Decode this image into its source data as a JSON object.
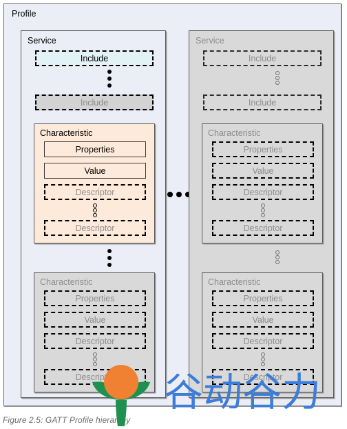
{
  "figure": {
    "caption": "Figure 2.5: GATT Profile hierarchy",
    "profile_label": "Profile"
  },
  "labels": {
    "service": "Service",
    "include": "Include",
    "characteristic": "Characteristic",
    "properties": "Properties",
    "value": "Value",
    "descriptor": "Descriptor"
  },
  "colors": {
    "profile_bg": "#eceef7",
    "service_active_bg": "#eceef7",
    "service_dim_bg": "#d9d9d9",
    "include_active_bg": "#e3f2f7",
    "include_dim_bg": "#d3d3d3",
    "characteristic_active_bg": "#fdeada",
    "characteristic_dim_bg": "#d9d9d9",
    "dim_text": "#8d8d8d",
    "active_text": "#000000",
    "border": "#555555",
    "caption_text": "#6b6b6b",
    "watermark_blue": "#3b7dd8",
    "watermark_orange": "#f08032",
    "watermark_green": "#1e9150"
  },
  "structure": {
    "services": [
      {
        "name": "Service",
        "state": "active",
        "includes": [
          {
            "label": "Include",
            "state": "active"
          },
          {
            "label": "Include",
            "state": "dim"
          }
        ],
        "characteristics": [
          {
            "name": "Characteristic",
            "state": "active",
            "properties": {
              "label": "Properties",
              "state": "active"
            },
            "value": {
              "label": "Value",
              "state": "active"
            },
            "descriptors": [
              {
                "label": "Descriptor",
                "state": "dim"
              },
              {
                "label": "Descriptor",
                "state": "dim"
              }
            ]
          },
          {
            "name": "Characteristic",
            "state": "dim",
            "properties": {
              "label": "Properties",
              "state": "dim"
            },
            "value": {
              "label": "Value",
              "state": "dim"
            },
            "descriptors": [
              {
                "label": "Descriptor",
                "state": "dim"
              },
              {
                "label": "Descriptor",
                "state": "dim"
              }
            ]
          }
        ]
      },
      {
        "name": "Service",
        "state": "dim",
        "includes": [
          {
            "label": "Include",
            "state": "dim"
          },
          {
            "label": "Include",
            "state": "dim"
          }
        ],
        "characteristics": [
          {
            "name": "Characteristic",
            "state": "dim",
            "properties": {
              "label": "Properties",
              "state": "dim"
            },
            "value": {
              "label": "Value",
              "state": "dim"
            },
            "descriptors": [
              {
                "label": "Descriptor",
                "state": "dim"
              },
              {
                "label": "Descriptor",
                "state": "dim"
              }
            ]
          },
          {
            "name": "Characteristic",
            "state": "dim",
            "properties": {
              "label": "Properties",
              "state": "dim"
            },
            "value": {
              "label": "Value",
              "state": "dim"
            },
            "descriptors": [
              {
                "label": "Descriptor",
                "state": "dim"
              },
              {
                "label": "Descriptor",
                "state": "dim"
              }
            ]
          }
        ]
      }
    ],
    "service_ellipsis": "•••"
  },
  "watermark": {
    "text": "谷动谷力",
    "logo_name": "sprout-sun-logo"
  }
}
